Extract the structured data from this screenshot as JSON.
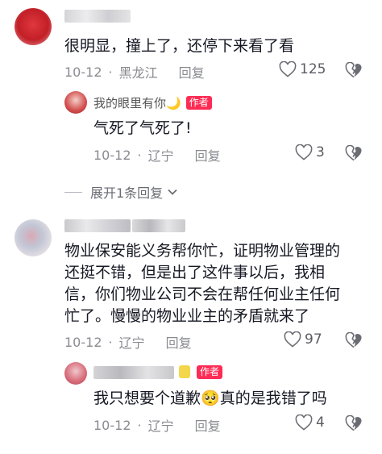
{
  "comments": [
    {
      "text": "很明显，撞上了，还停下来看了看",
      "date": "10-12",
      "location": "黑龙江",
      "reply_label": "回复",
      "likes": "125",
      "replies": [
        {
          "username": "我的眼里有你🌙",
          "badge": "作者",
          "text": "气死了气死了!",
          "date": "10-12",
          "location": "辽宁",
          "reply_label": "回复",
          "likes": "3"
        }
      ],
      "expand_label": "展开1条回复"
    },
    {
      "text_lines": [
        "物业保安能义务帮你忙，证明物业管理的",
        "还挺不错，但是出了这件事以后，我相",
        "信，你们物业公司不会在帮任何业主任何",
        "忙了。慢慢的物业业主的矛盾就来了"
      ],
      "date": "10-12",
      "location": "辽宁",
      "reply_label": "回复",
      "likes": "97",
      "replies": [
        {
          "badge": "作者",
          "text_before": "我只想要个道歉",
          "emoji": "🥺",
          "text_after": "真的是我错了吗",
          "date": "10-12",
          "location": "辽宁",
          "reply_label": "回复",
          "likes": "4"
        }
      ]
    }
  ],
  "colors": {
    "badge": "#fe2c55",
    "meta": "#8a8b91",
    "text": "#161823"
  }
}
